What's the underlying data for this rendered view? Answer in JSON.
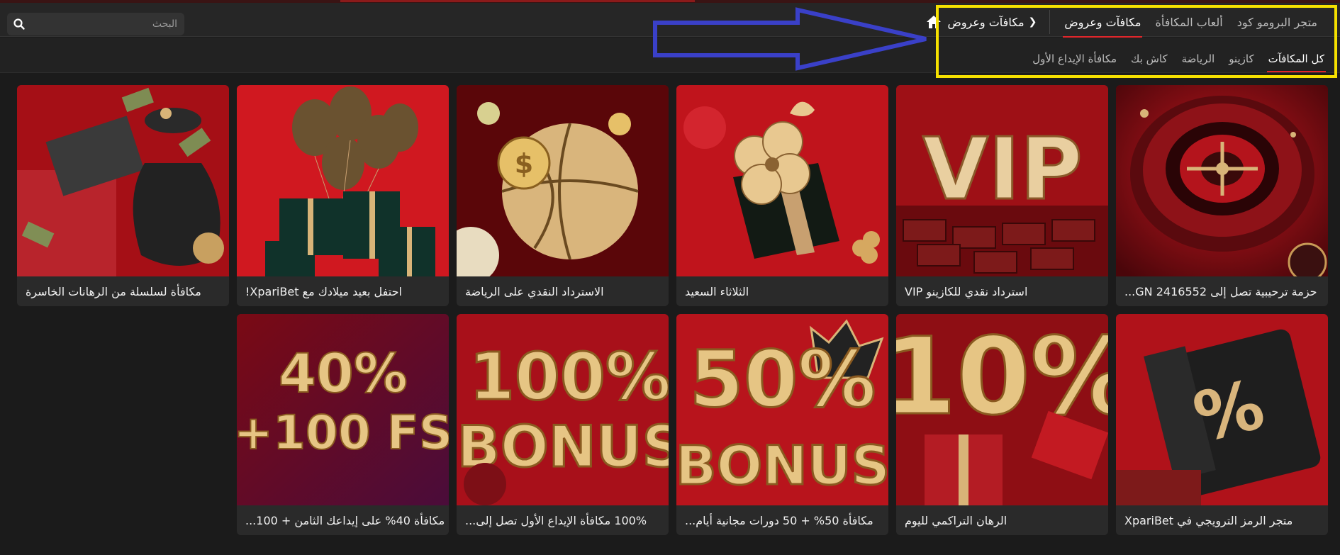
{
  "search": {
    "placeholder": "البحث"
  },
  "breadcrumb": {
    "label": "مكافآت وعروض"
  },
  "top_nav": [
    {
      "label": "مكافآت وعروض",
      "active": true
    },
    {
      "label": "ألعاب المكافأة",
      "active": false
    },
    {
      "label": "متجر البرومو كود",
      "active": false
    }
  ],
  "sub_nav": [
    {
      "label": "مكافأة الإيداع الأول",
      "active": false
    },
    {
      "label": "كاش بك",
      "active": false
    },
    {
      "label": "الرياضة",
      "active": false
    },
    {
      "label": "كازينو",
      "active": false
    },
    {
      "label": "كل المكافآت",
      "active": true
    }
  ],
  "promos": [
    {
      "title": "حزمة ترحيبية تصل إلى 2416552 GN...",
      "theme": "roulette"
    },
    {
      "title": "استرداد نقدي للكازينو VIP",
      "theme": "vip",
      "art_text": "VIP"
    },
    {
      "title": "الثلاثاء السعيد",
      "theme": "clover-gift"
    },
    {
      "title": "الاسترداد النقدي على الرياضة",
      "theme": "basketball-coins"
    },
    {
      "title": "احتفل بعيد ميلادك مع XpariBet!",
      "theme": "balloons-gifts"
    },
    {
      "title": "مكافأة لسلسلة من الرهانات الخاسرة",
      "theme": "money-bag"
    },
    {
      "title": "متجر الرمز الترويجي في XpariBet",
      "theme": "promo-ticket",
      "art_text": "%"
    },
    {
      "title": "الرهان التراكمي لليوم",
      "theme": "ten-percent",
      "art_text": "10%"
    },
    {
      "title": "مكافأة 50% + 50 دورات مجانية أيام...",
      "theme": "fifty-bonus",
      "art_text": "50% BONUS"
    },
    {
      "title": "100% مكافأة الإيداع الأول تصل إلى...",
      "theme": "hundred-bonus",
      "art_text": "100% BONUS"
    },
    {
      "title": "مكافأة 40% على إيداعك الثامن + 100...",
      "theme": "forty-fs",
      "art_text": "40% +100 FS"
    }
  ],
  "colors": {
    "accent": "#e0262b",
    "highlight": "#f5e000",
    "arrow": "#3a40c8",
    "card_red": "#b3121a"
  }
}
